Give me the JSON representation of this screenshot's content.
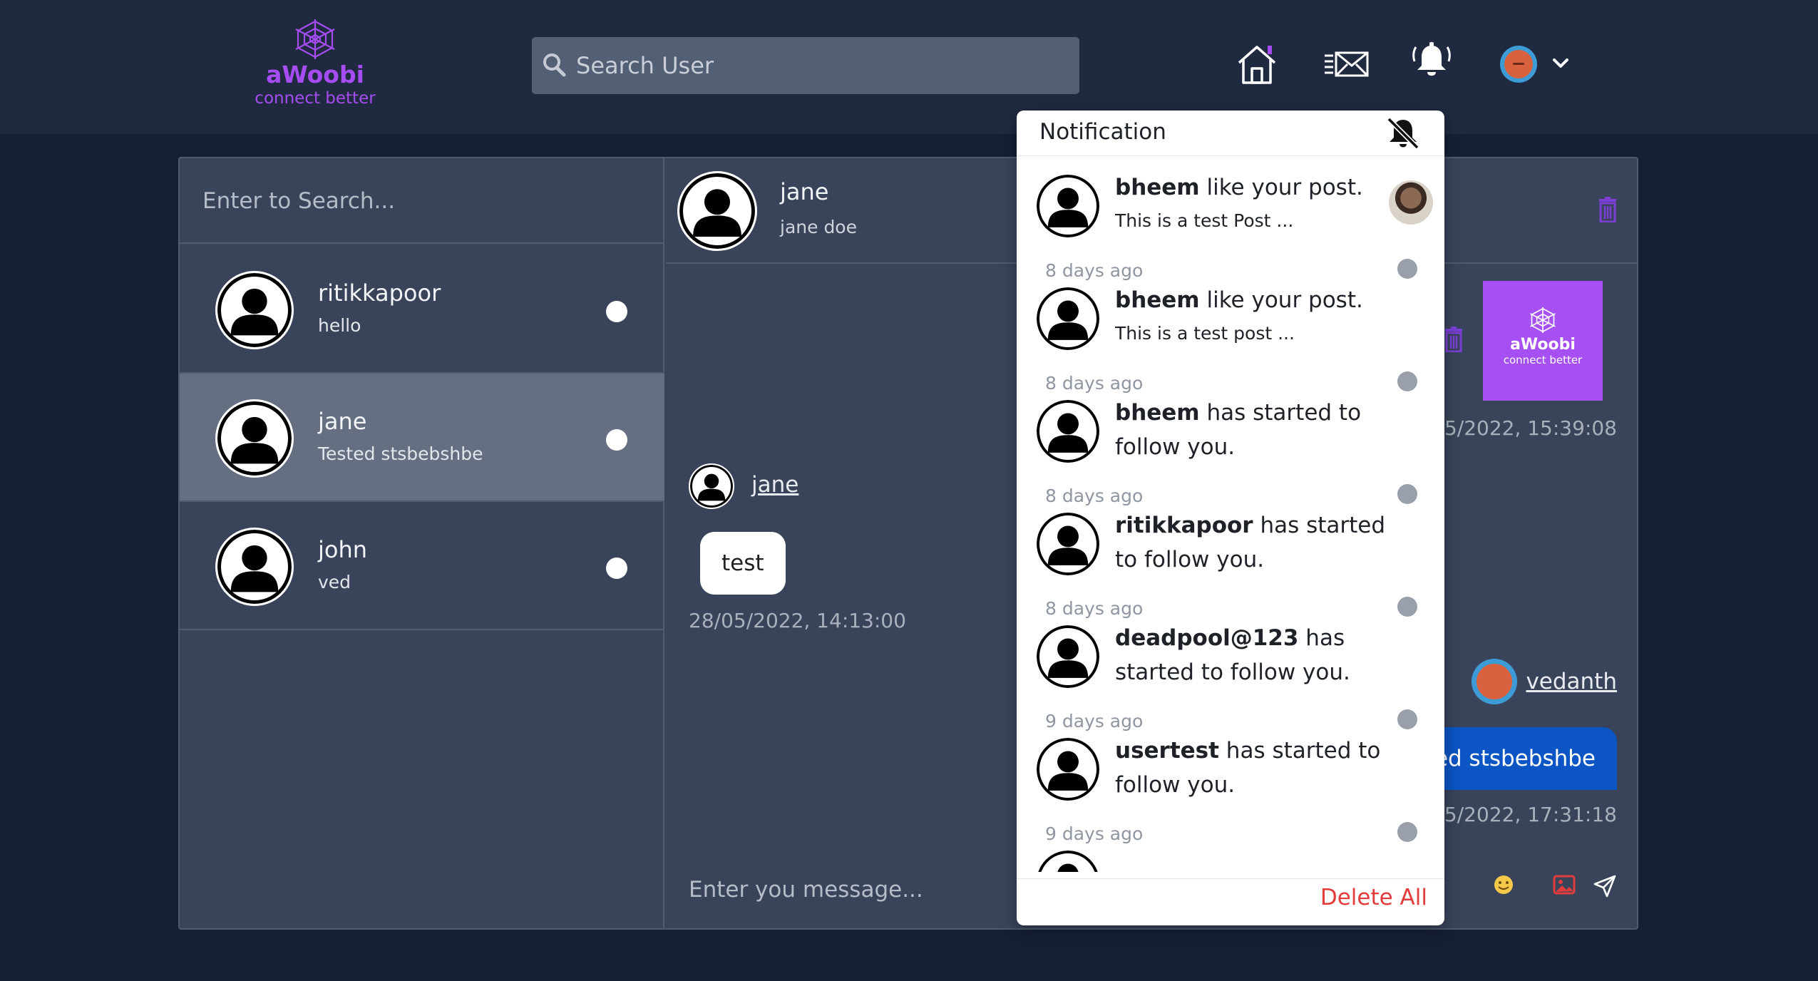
{
  "brand": {
    "name": "aWoobi",
    "tagline": "connect better",
    "color": "#a54df0"
  },
  "header": {
    "search_placeholder": "Search User"
  },
  "sidebar": {
    "search_placeholder": "Enter to Search...",
    "contacts": [
      {
        "name": "ritikkapoor",
        "last_message": "hello",
        "active": false
      },
      {
        "name": "jane",
        "last_message": "Tested stsbebshbe",
        "active": true
      },
      {
        "name": "john",
        "last_message": "ved",
        "active": false
      }
    ]
  },
  "chat": {
    "header": {
      "name": "jane",
      "subtitle": "jane doe"
    },
    "incoming": {
      "sender": "jane",
      "text": "test",
      "timestamp": "28/05/2022, 14:13:00"
    },
    "image_post": {
      "brand": "aWoobi",
      "tagline": "connect better",
      "timestamp": "05/2022, 15:39:08"
    },
    "outgoing": {
      "sender": "vedanth",
      "text": "ed stsbebshbe",
      "timestamp": "/05/2022, 17:31:18"
    },
    "input_placeholder": "Enter you message..."
  },
  "notifications": {
    "title": "Notification",
    "items": [
      {
        "user": "bheem",
        "action": " like your post.",
        "detail": "This is a test Post ...",
        "time": "8 days ago",
        "has_thumb": true
      },
      {
        "user": "bheem",
        "action": " like your post.",
        "detail": "This is a test post ...",
        "time": "8 days ago",
        "has_thumb": false
      },
      {
        "user": "bheem",
        "action": " has started to follow you.",
        "detail": "",
        "time": "8 days ago",
        "has_thumb": false
      },
      {
        "user": "ritikkapoor",
        "action": " has started to follow you.",
        "detail": "",
        "time": "8 days ago",
        "has_thumb": false
      },
      {
        "user": "deadpool@123",
        "action": " has started to follow you.",
        "detail": "",
        "time": "9 days ago",
        "has_thumb": false
      },
      {
        "user": "usertest",
        "action": " has started to follow you.",
        "detail": "",
        "time": "9 days ago",
        "has_thumb": false
      }
    ],
    "delete_all_label": "Delete All",
    "delete_color": "#e23b3b"
  },
  "icons": {
    "home": "home-icon",
    "messages": "mail-icon",
    "notifications": "bell-icon",
    "mute": "bell-off-icon",
    "trash": "trash-icon",
    "emoji": "emoji-icon",
    "image": "image-icon",
    "send": "send-icon"
  }
}
